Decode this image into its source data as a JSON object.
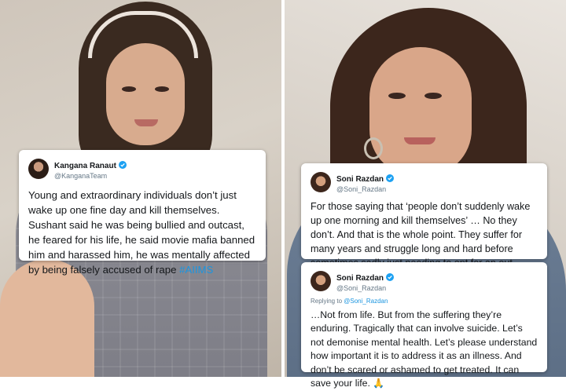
{
  "tweets": {
    "kangana": {
      "display_name": "Kangana Ranaut",
      "handle": "@KanganaTeam",
      "text": "Young and extraordinary individuals don’t just wake up one fine day and kill themselves. Sushant said he was being bullied and outcast, he feared for his life, he said movie mafia banned him and harassed him, he was mentally affected by being falsely accused of rape",
      "hashtag": "#AIIMS"
    },
    "soni_1": {
      "display_name": "Soni Razdan",
      "handle": "@Soni_Razdan",
      "text": "For those saying that ‘people don’t suddenly wake up one morning and kill themselves’ … No they don’t. And that is the whole point. They suffer for many years and struggle long and hard before sometimes sadly just needing to opt for an out."
    },
    "soni_2": {
      "display_name": "Soni Razdan",
      "handle": "@Soni_Razdan",
      "reply_prefix": "Replying to",
      "reply_to": "@Soni_Razdan",
      "text": "…Not from life. But from the suffering they’re enduring. Tragically that can involve suicide. Let’s not demonise mental health. Let’s please understand how important it is to address it as an illness. And don’t be scared or ashamed to get treated. It can save your life.",
      "emoji": "🙏"
    }
  },
  "colors": {
    "verified": "#1da1f2",
    "link": "#1b95e0"
  },
  "icons": {
    "verified": "verified-badge-icon"
  }
}
